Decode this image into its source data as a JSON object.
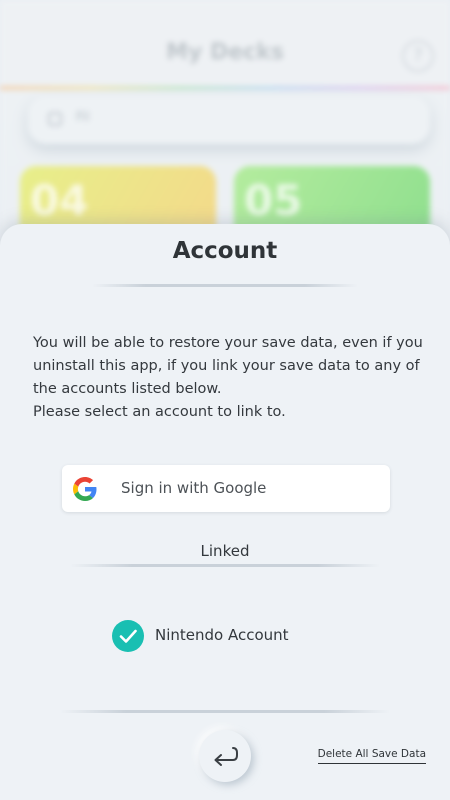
{
  "background": {
    "title": "My Decks",
    "help_icon": "question-mark-icon",
    "search_placeholder": "Fil",
    "cards": [
      "04",
      "05"
    ]
  },
  "modal": {
    "title": "Account",
    "description": [
      "You will be able to restore your save data, even if you uninstall this app, if you link your save data to any of the accounts listed below.",
      "Please select an account to link to."
    ],
    "google_button": {
      "label": "Sign in with Google",
      "icon": "google-logo-icon"
    },
    "linked_heading": "Linked",
    "linked_accounts": [
      {
        "label": "Nintendo Account",
        "icon": "checkmark-icon",
        "status_color": "#19bfb2"
      }
    ],
    "back_icon": "return-arrow-icon",
    "delete_link": "Delete All Save Data"
  },
  "colors": {
    "accent_teal": "#19bfb2",
    "sheet_background": "#eef2f6"
  }
}
